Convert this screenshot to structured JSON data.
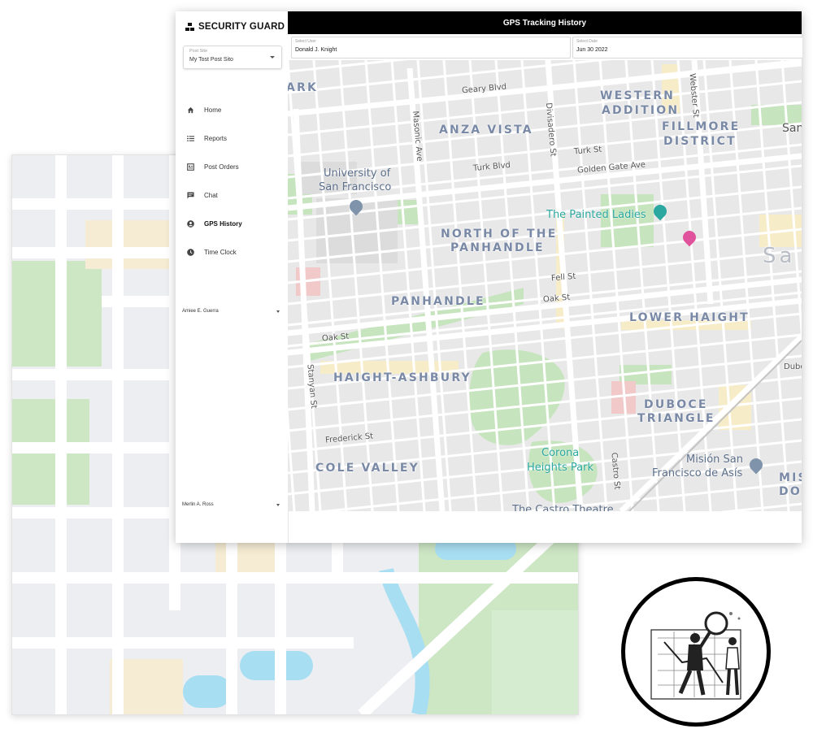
{
  "app": {
    "brand": "SECURITY GUARD",
    "header_title": "GPS Tracking History"
  },
  "sidebar": {
    "post_site": {
      "label": "Post Site",
      "value": "My Tost Post Sito"
    },
    "nav": [
      {
        "label": "Home",
        "icon": "home-icon"
      },
      {
        "label": "Reports",
        "icon": "list-icon"
      },
      {
        "label": "Post Orders",
        "icon": "clipboard-icon"
      },
      {
        "label": "Chat",
        "icon": "chat-icon"
      },
      {
        "label": "GPS History",
        "icon": "user-location-icon",
        "active": true
      },
      {
        "label": "Time Clock",
        "icon": "clock-icon"
      }
    ],
    "users": [
      "Amiee E. Guerra",
      "Merlin A. Ross"
    ]
  },
  "filters": {
    "user": {
      "label": "Select User",
      "value": "Donald J. Knight"
    },
    "date": {
      "label": "Select Date",
      "value": "Jun 30 2022"
    }
  },
  "map": {
    "districts": [
      "ARK",
      "WESTERN",
      "ADDITION",
      "ANZA VISTA",
      "FILLMORE",
      "DISTRICT",
      "NORTH OF THE",
      "PANHANDLE",
      "PANHANDLE",
      "LOWER HAIGHT",
      "HAIGHT-ASHBURY",
      "DUBOCE",
      "TRIANGLE",
      "COLE VALLEY",
      "MIS",
      "DO"
    ],
    "streets": [
      "Geary Blvd",
      "Masonic Ave",
      "Divisadero St",
      "Webster St",
      "Turk St",
      "Turk Blvd",
      "Golden Gate Ave",
      "Fell St",
      "Oak St",
      "Oak St",
      "Stanyan St",
      "Frederick St",
      "Castro St",
      "Dubo",
      "San",
      "Sa"
    ],
    "pois": [
      "University of",
      "San Francisco",
      "The Painted Ladies",
      "Corona",
      "Heights Park",
      "Misión San",
      "Francisco de Asís",
      "The Castro Theatre"
    ]
  },
  "colors": {
    "header": "#000000",
    "park": "#c9e6c2",
    "district_label": "#7a8aa6",
    "poi_teal": "#2ba8a0",
    "pin_pink": "#e0529c"
  }
}
